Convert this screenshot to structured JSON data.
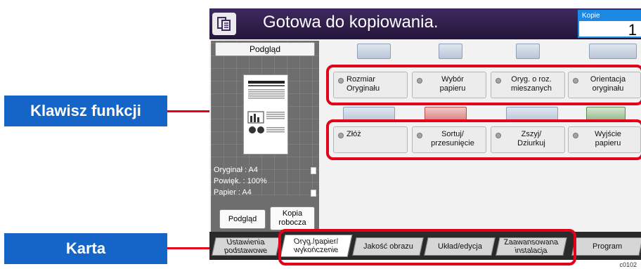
{
  "callouts": {
    "function_keys": "Klawisz funkcji",
    "tab": "Karta"
  },
  "header": {
    "title": "Gotowa do kopiowania.",
    "copies_label": "Kopie",
    "copies_value": "1"
  },
  "preview": {
    "title": "Podgląd",
    "original": "Oryginał  : A4",
    "zoom": "Powięk.  : 100%",
    "paper": "Papier    : A4"
  },
  "left_buttons": {
    "preview": "Podgląd",
    "draft_line1": "Kopia",
    "draft_line2": "robocza"
  },
  "function_keys": [
    {
      "line1": "Rozmiar",
      "line2": "Oryginału"
    },
    {
      "line1": "Wybór",
      "line2": "papieru"
    },
    {
      "line1": "Oryg. o roz.",
      "line2": "mieszanych"
    },
    {
      "line1": "Orientacja",
      "line2": "oryginału"
    },
    {
      "line1": "Złóż",
      "line2": ""
    },
    {
      "line1": "Sortuj/",
      "line2": "przesunięcie"
    },
    {
      "line1": "Zszyj/",
      "line2": "Dziurkuj"
    },
    {
      "line1": "Wyjście",
      "line2": "papieru"
    }
  ],
  "tabs": [
    {
      "line1": "Ustawienia",
      "line2": "podstawowe"
    },
    {
      "line1": "Oryg./papier/",
      "line2": "wykończenie"
    },
    {
      "line1": "Jakość obrazu",
      "line2": ""
    },
    {
      "line1": "Układ/edycja",
      "line2": ""
    },
    {
      "line1": "Zaawansowana",
      "line2": "instalacja"
    },
    {
      "line1": "Program",
      "line2": ""
    }
  ],
  "figure_code": "c0102",
  "colors": {
    "callout_bg": "#1565c8",
    "highlight": "#e2001a",
    "header_bg": "#2e1d47",
    "copies_accent": "#1e88e5"
  }
}
